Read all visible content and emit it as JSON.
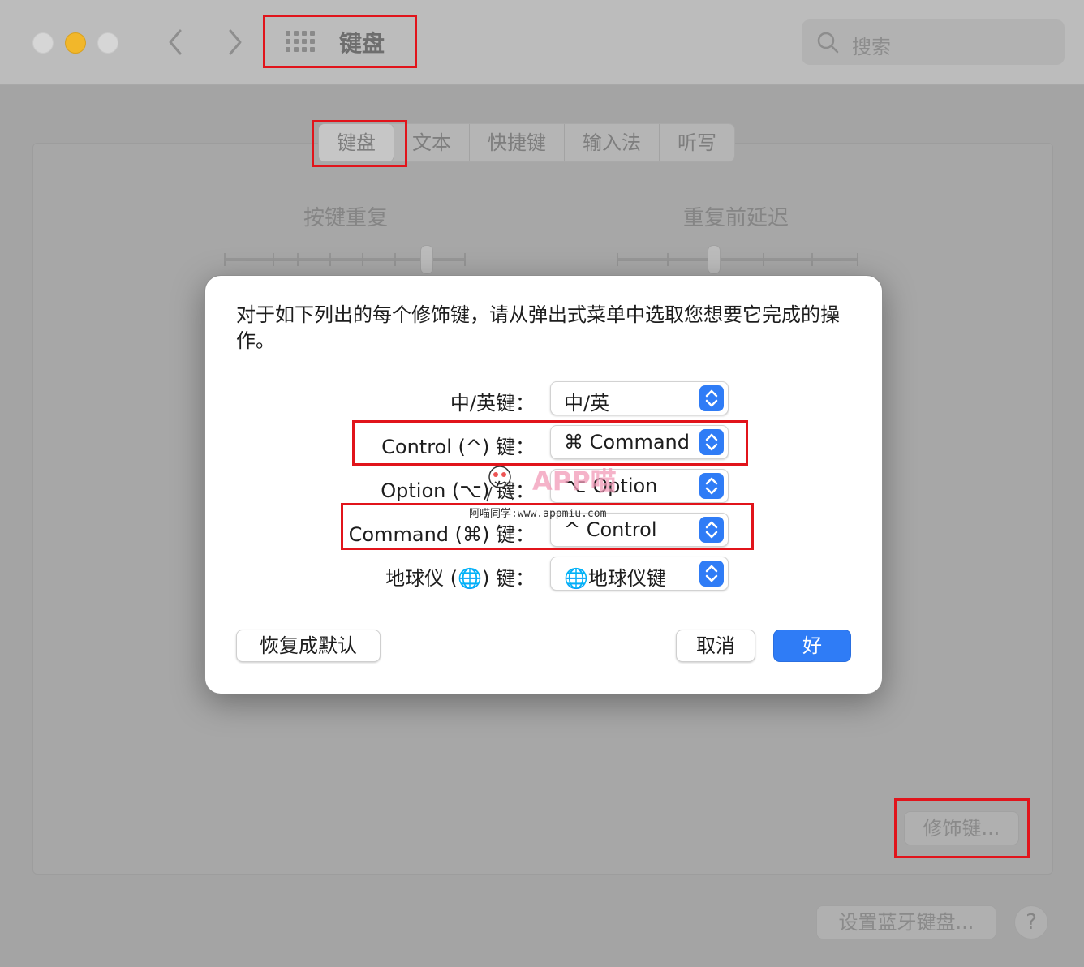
{
  "titlebar": {
    "title": "键盘",
    "search_placeholder": "搜索",
    "back": "‹",
    "forward": "›"
  },
  "tabs": [
    {
      "label": "键盘",
      "active": true
    },
    {
      "label": "文本",
      "active": false
    },
    {
      "label": "快捷键",
      "active": false
    },
    {
      "label": "输入法",
      "active": false
    },
    {
      "label": "听写",
      "active": false
    }
  ],
  "sliders": {
    "key_repeat_label": "按键重复",
    "delay_label": "重复前延迟"
  },
  "buttons": {
    "modifier_keys": "修饰键...",
    "bluetooth_keyboard": "设置蓝牙键盘...",
    "help": "?"
  },
  "dialog": {
    "intro": "对于如下列出的每个修饰键，请从弹出式菜单中选取您想要它完成的操作。",
    "rows": [
      {
        "label": "中/英键：",
        "value": "中/英"
      },
      {
        "label": "Control (^) 键：",
        "value": "⌘ Command"
      },
      {
        "label": "Option (⌥) 键：",
        "value": "⌥ Option"
      },
      {
        "label": "Command (⌘) 键：",
        "value": "^ Control"
      },
      {
        "label": "地球仪 (🌐) 键：",
        "value": "🌐地球仪键"
      }
    ],
    "restore_defaults": "恢复成默认",
    "cancel": "取消",
    "ok": "好"
  },
  "watermark": {
    "brand": "APP喵",
    "url": "阿喵同学:www.appmiu.com"
  },
  "colors": {
    "accent": "#2f7cf6",
    "highlight_box": "#e1141b",
    "minimize": "#f2b72a"
  }
}
